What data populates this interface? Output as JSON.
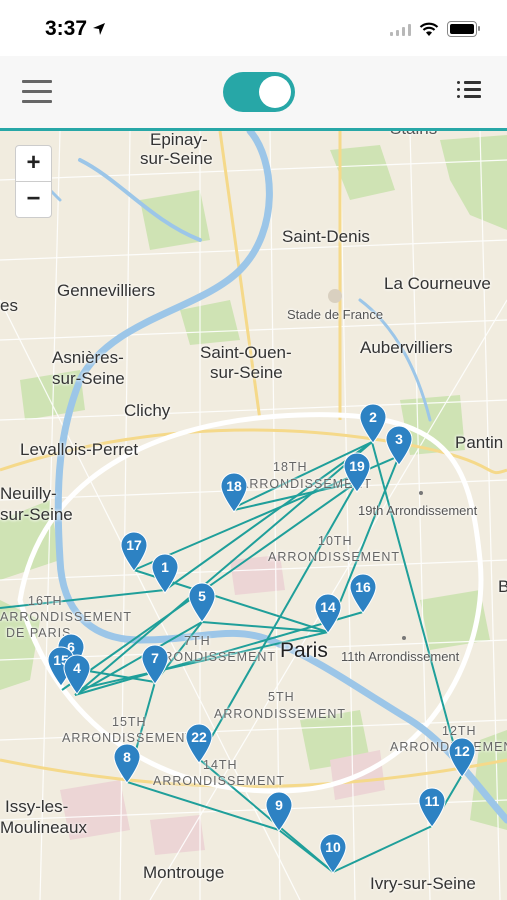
{
  "status_bar": {
    "time": "3:37"
  },
  "toolbar": {
    "toggle_on": true
  },
  "map": {
    "zoom_in": "+",
    "zoom_out": "−",
    "labels": {
      "epinay": "Epinay-",
      "epinay2": "sur-Seine",
      "stains": "Stains",
      "saint_denis": "Saint-Denis",
      "la_courneuve": "La Courneuve",
      "gennevilliers": "Gennevilliers",
      "stade": "Stade de France",
      "asnieres": "Asnières-",
      "asnieres2": "sur-Seine",
      "saint_ouen": "Saint-Ouen-",
      "saint_ouen2": "sur-Seine",
      "aubervilliers": "Aubervilliers",
      "clichy": "Clichy",
      "levallois": "Levallois-Perret",
      "pantin": "Pantin",
      "neuilly": "Neuilly-",
      "neuilly2": "sur-Seine",
      "arr18": "18TH",
      "arr18b": "ARRONDISSEMENT",
      "arr19": "19th Arrondissement",
      "arr10": "10TH",
      "arr10b": "ARRONDISSEMENT",
      "arr16": "16TH",
      "arr16b": "ARRONDISSEMENT",
      "arr16c": "DE PARIS",
      "arr7": "7TH",
      "arr7b": "ARRONDISSEMENT",
      "paris": "Paris",
      "arr11": "11th Arrondissement",
      "arr5": "5TH",
      "arr5b": "ARRONDISSEMENT",
      "arr15": "15TH",
      "arr15b": "ARRONDISSEMENT",
      "arr14": "14TH",
      "arr14b": "ARRONDISSEMENT",
      "arr12": "12TH",
      "arr12b": "ARRONDISSEMENT",
      "issy": "Issy-les-",
      "issy2": "Moulineaux",
      "montrouge": "Montrouge",
      "ivry": "Ivry-sur-Seine",
      "es": "es",
      "b": "B"
    },
    "pins": [
      {
        "label": "1"
      },
      {
        "label": "2"
      },
      {
        "label": "3"
      },
      {
        "label": "4"
      },
      {
        "label": "5"
      },
      {
        "label": "6"
      },
      {
        "label": "7"
      },
      {
        "label": "8"
      },
      {
        "label": "9"
      },
      {
        "label": "10"
      },
      {
        "label": "11"
      },
      {
        "label": "12"
      },
      {
        "label": "14"
      },
      {
        "label": "15"
      },
      {
        "label": "16"
      },
      {
        "label": "17"
      },
      {
        "label": "18"
      },
      {
        "label": "19"
      },
      {
        "label": "22"
      }
    ],
    "route_color": "#1f9f9a",
    "pin_color": "#2d82c3"
  }
}
